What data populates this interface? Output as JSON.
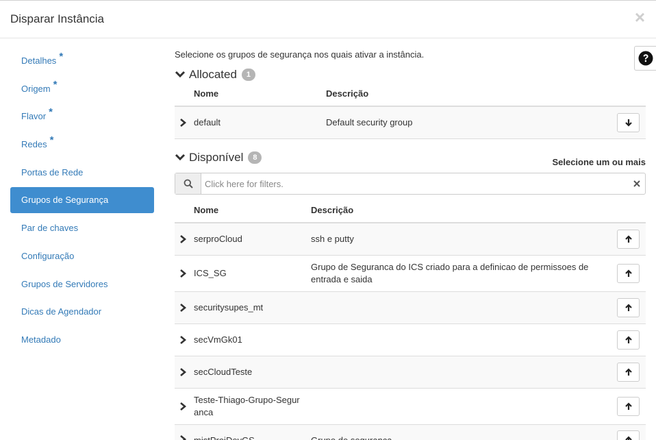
{
  "modal": {
    "title": "Disparar Instância",
    "close_symbol": "×"
  },
  "sidebar": {
    "items": [
      {
        "label": "Detalhes",
        "required": true
      },
      {
        "label": "Origem",
        "required": true
      },
      {
        "label": "Flavor",
        "required": true
      },
      {
        "label": "Redes",
        "required": true
      },
      {
        "label": "Portas de Rede",
        "required": false
      },
      {
        "label": "Grupos de Segurança",
        "required": false,
        "active": true
      },
      {
        "label": "Par de chaves",
        "required": false
      },
      {
        "label": "Configuração",
        "required": false
      },
      {
        "label": "Grupos de Servidores",
        "required": false
      },
      {
        "label": "Dicas de Agendador",
        "required": false
      },
      {
        "label": "Metadado",
        "required": false
      }
    ],
    "required_marker": "*"
  },
  "content": {
    "intro": "Selecione os grupos de segurança nos quais ativar a instância.",
    "help_icon": "question-circle-icon",
    "allocated": {
      "title": "Allocated",
      "count": "1",
      "columns": {
        "name": "Nome",
        "description": "Descrição"
      },
      "rows": [
        {
          "name": "default",
          "description": "Default security group"
        }
      ]
    },
    "available": {
      "title": "Disponível",
      "count": "8",
      "select_hint": "Selecione um ou mais",
      "filter_placeholder": "Click here for filters.",
      "columns": {
        "name": "Nome",
        "description": "Descrição"
      },
      "rows": [
        {
          "name": "serproCloud",
          "description": "ssh e putty"
        },
        {
          "name": "ICS_SG",
          "description": "Grupo de Seguranca do ICS criado para a definicao de permissoes de entrada e saida"
        },
        {
          "name": "securitysupes_mt",
          "description": ""
        },
        {
          "name": "secVmGk01",
          "description": ""
        },
        {
          "name": "secCloudTeste",
          "description": ""
        },
        {
          "name": "Teste-Thiago-Grupo-Seguranca",
          "description": ""
        },
        {
          "name": "mistProjDevGS",
          "description": "Grupo de segurança"
        }
      ]
    }
  },
  "colors": {
    "link": "#337ab7",
    "active_nav_bg": "#3f8dcf",
    "badge_bg": "#b5b5b5",
    "border": "#dddddd"
  }
}
